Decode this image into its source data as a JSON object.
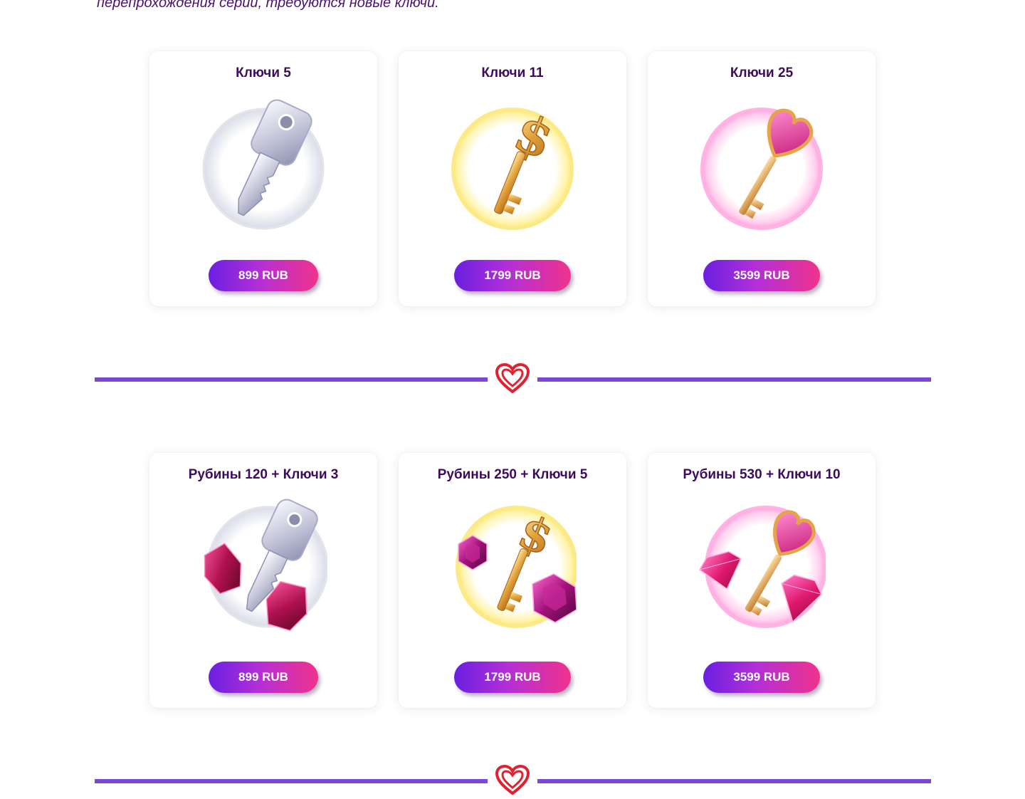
{
  "intro": {
    "text": "перепрохождения серий, требуются новые ключи."
  },
  "keys_section": {
    "cards": [
      {
        "title": "Ключи 5",
        "price": "899 RUB",
        "icon": "silver-key-icon"
      },
      {
        "title": "Ключи 11",
        "price": "1799 RUB",
        "icon": "gold-dollar-key-icon"
      },
      {
        "title": "Ключи 25",
        "price": "3599 RUB",
        "icon": "pink-heart-key-icon"
      }
    ]
  },
  "bundles_section": {
    "cards": [
      {
        "title": "Рубины 120 + Ключи 3",
        "price": "899 RUB",
        "icon": "silver-key-rubies-icon"
      },
      {
        "title": "Рубины 250 + Ключи 5",
        "price": "1799 RUB",
        "icon": "gold-key-rubies-icon"
      },
      {
        "title": "Рубины 530 + Ключи 10",
        "price": "3599 RUB",
        "icon": "heart-key-diamonds-icon"
      }
    ]
  },
  "divider": {
    "icon": "heart-icon"
  },
  "colors": {
    "title_text": "#3d0a5c",
    "intro_text": "#4b1170",
    "divider_line": "#7b47d4",
    "button_gradient_start": "#6a1fe0",
    "button_gradient_end": "#f0328c",
    "heart_red": "#e0212f"
  }
}
